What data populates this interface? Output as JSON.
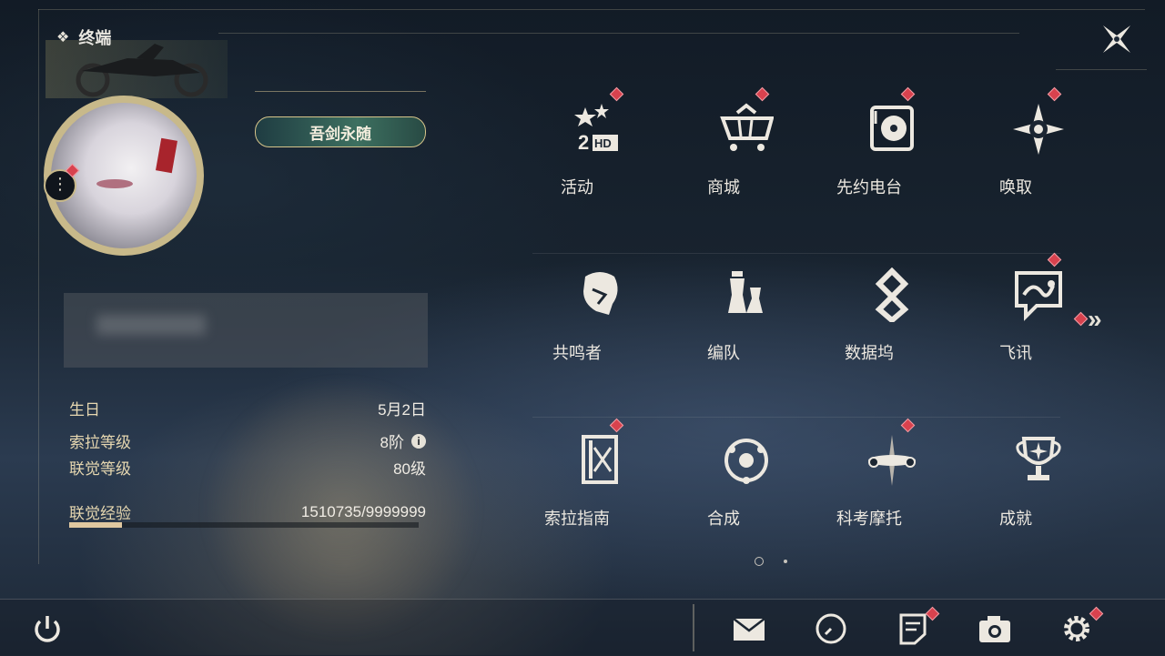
{
  "header": {
    "title": "终端"
  },
  "profile": {
    "title_badge": "吾剑永随",
    "birthday_label": "生日",
    "birthday_value": "5月2日",
    "sola_level_label": "索拉等级",
    "sola_level_value": "8阶",
    "union_level_label": "联觉等级",
    "union_level_value": "80级",
    "union_exp_label": "联觉经验",
    "union_exp_value": "1510735/9999999",
    "union_exp_progress": 0.151
  },
  "menu": {
    "row1": [
      "活动",
      "商城",
      "先约电台",
      "唤取"
    ],
    "row2": [
      "共鸣者",
      "编队",
      "数据坞",
      "飞讯"
    ],
    "row3": [
      "索拉指南",
      "合成",
      "科考摩托",
      "成就"
    ]
  },
  "colors": {
    "accent_red": "#d8424e",
    "gold": "#c8b98a"
  },
  "pager": {
    "pages": 2,
    "current": 1
  }
}
